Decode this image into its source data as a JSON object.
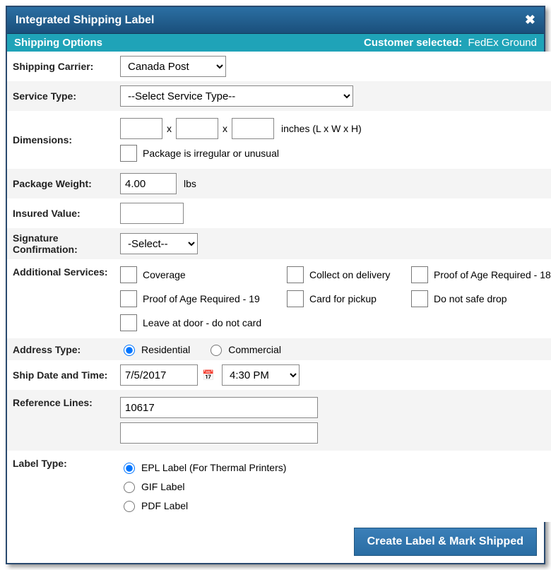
{
  "dialog": {
    "title": "Integrated Shipping Label"
  },
  "subtitle": {
    "left": "Shipping Options",
    "right_label": "Customer selected:",
    "right_value": "FedEx Ground"
  },
  "labels": {
    "carrier": "Shipping Carrier:",
    "service": "Service Type:",
    "dimensions": "Dimensions:",
    "dim_hint": "inches (L x W x H)",
    "irregular": "Package is irregular or unusual",
    "weight": "Package Weight:",
    "weight_unit": "lbs",
    "insured": "Insured Value:",
    "sig": "Signature Confirmation:",
    "additional": "Additional Services:",
    "address_type": "Address Type:",
    "ship_dt": "Ship Date and Time:",
    "ref": "Reference Lines:",
    "label_type": "Label Type:"
  },
  "values": {
    "carrier": "Canada Post",
    "service": "--Select Service Type--",
    "dim_l": "",
    "dim_w": "",
    "dim_h": "",
    "weight": "4.00",
    "insured": "",
    "sig": "-Select--",
    "ship_date": "7/5/2017",
    "ship_time": "4:30 PM",
    "ref1": "10617",
    "ref2": ""
  },
  "services": {
    "coverage": "Coverage",
    "cod": "Collect on delivery",
    "age18": "Proof of Age Required - 18",
    "age19": "Proof of Age Required - 19",
    "card_pickup": "Card for pickup",
    "no_safe_drop": "Do not safe drop",
    "leave_at_door": "Leave at door - do not card"
  },
  "address_types": {
    "residential": "Residential",
    "commercial": "Commercial"
  },
  "label_types": {
    "epl": "EPL Label (For Thermal Printers)",
    "gif": "GIF Label",
    "pdf": "PDF Label"
  },
  "footer": {
    "button": "Create Label & Mark Shipped"
  }
}
